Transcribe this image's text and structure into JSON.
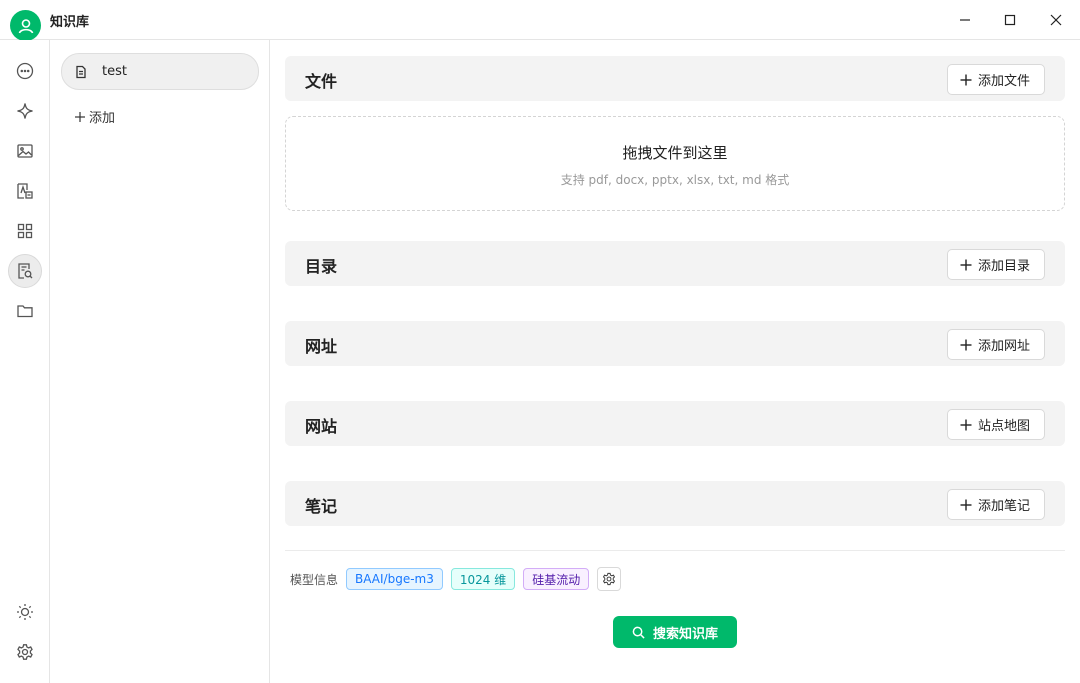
{
  "app": {
    "title": "知识库"
  },
  "window_controls": {
    "icons": [
      "minimize-icon",
      "maximize-icon",
      "close-icon"
    ]
  },
  "rail": {
    "top_icons": [
      "chat-icon",
      "sparkle-icon",
      "image-icon",
      "translate-icon",
      "apps-grid-icon",
      "knowledge-base-icon",
      "folder-icon"
    ],
    "active": "knowledge-base-icon",
    "bottom_icons": [
      "theme-sun-icon",
      "settings-icon"
    ]
  },
  "knowledge_list": {
    "items": [
      {
        "label": "test",
        "icon": "document-icon"
      }
    ],
    "add_label": "添加"
  },
  "sections": {
    "files": {
      "title": "文件",
      "button": "添加文件"
    },
    "directory": {
      "title": "目录",
      "button": "添加目录"
    },
    "url": {
      "title": "网址",
      "button": "添加网址"
    },
    "website": {
      "title": "网站",
      "button": "站点地图"
    },
    "notes": {
      "title": "笔记",
      "button": "添加笔记"
    }
  },
  "dropzone": {
    "title": "拖拽文件到这里",
    "hint": "支持 pdf, docx, pptx, xlsx, txt, md 格式"
  },
  "model_info": {
    "label": "模型信息",
    "model": "BAAI/bge-m3",
    "dimensions": "1024 维",
    "provider": "硅基流动"
  },
  "search_button": {
    "label": "搜索知识库"
  },
  "colors": {
    "accent": "#00b96b",
    "tag_blue": "#1677ff",
    "tag_cyan": "#08979c",
    "tag_purple": "#531dab"
  }
}
